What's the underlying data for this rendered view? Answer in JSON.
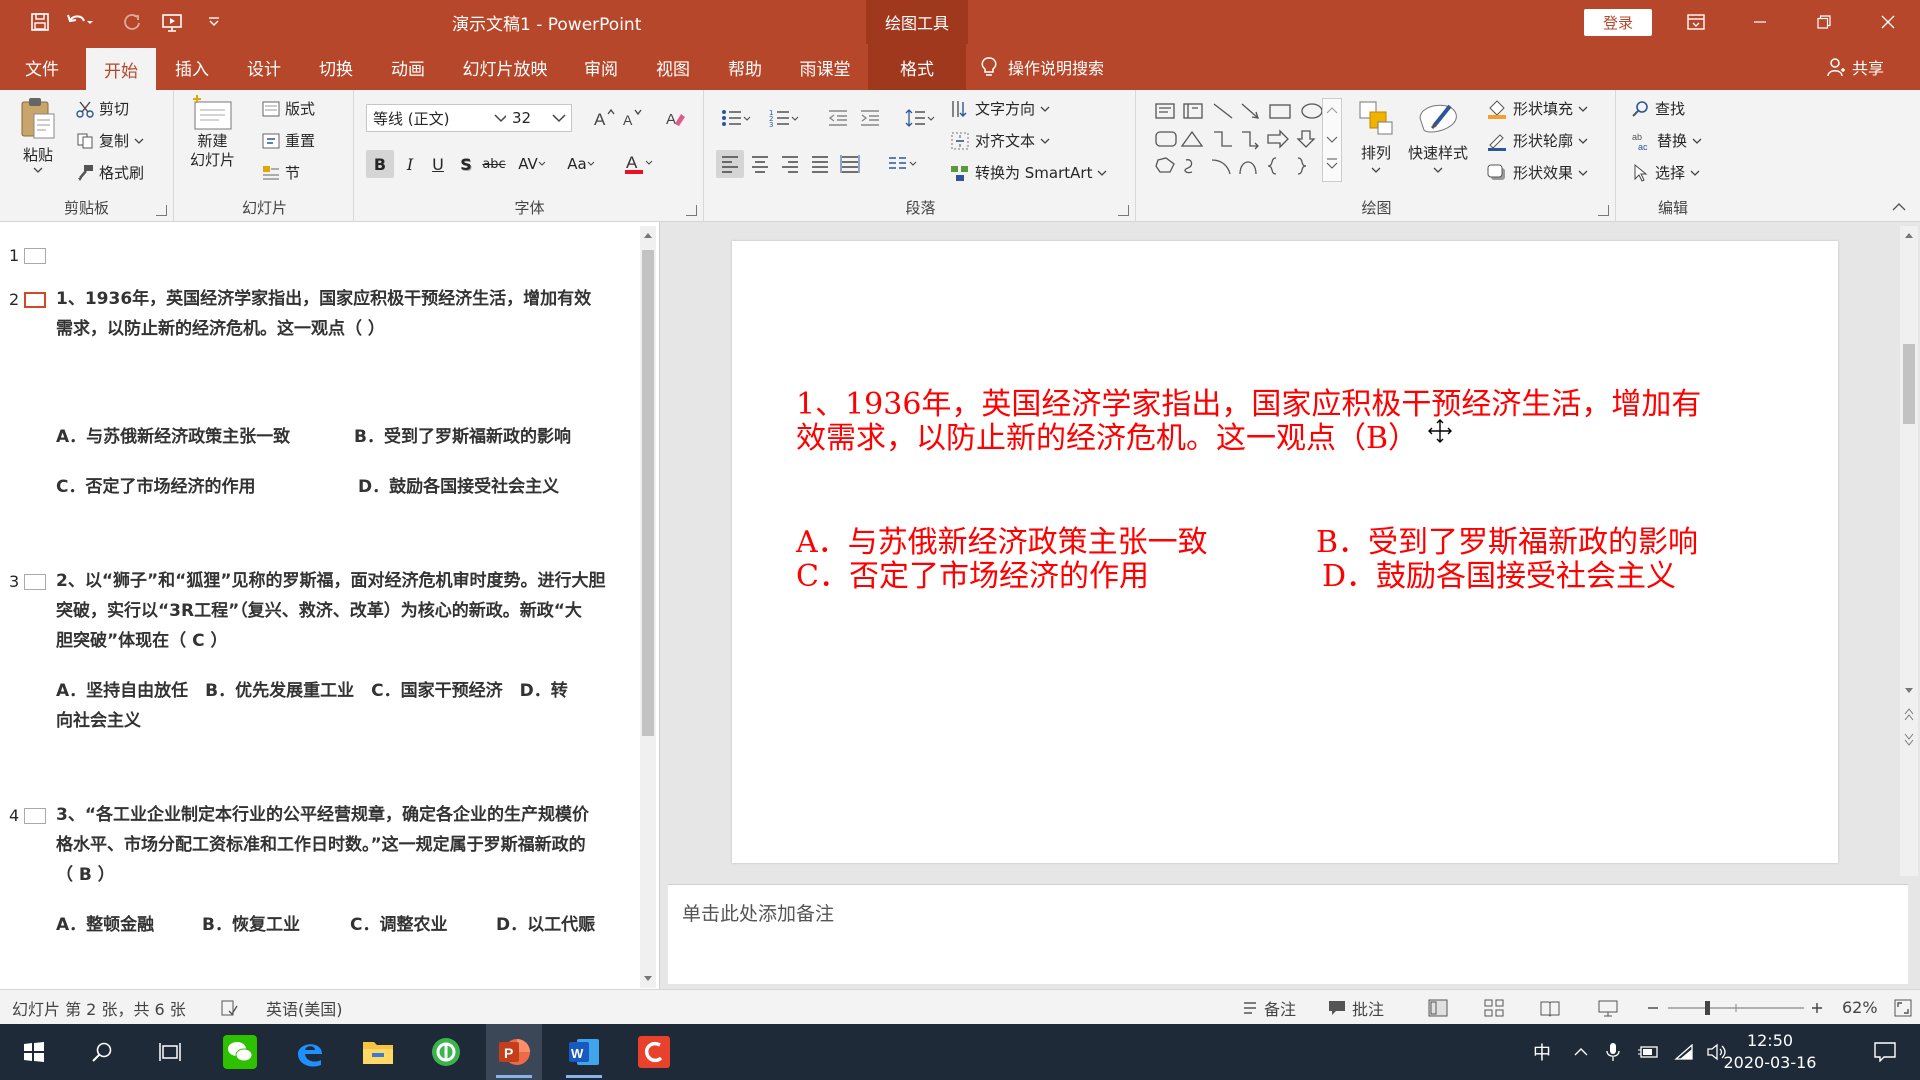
{
  "window": {
    "title": "演示文稿1  -  PowerPoint",
    "context_tool": "绘图工具",
    "login": "登录"
  },
  "tabs": [
    "文件",
    "开始",
    "插入",
    "设计",
    "切换",
    "动画",
    "幻灯片放映",
    "审阅",
    "视图",
    "帮助",
    "雨课堂",
    "格式"
  ],
  "tell_me": "操作说明搜索",
  "share": "共享",
  "ribbon": {
    "clipboard": {
      "paste": "粘贴",
      "cut": "剪切",
      "copy": "复制",
      "format_painter": "格式刷",
      "label": "剪贴板"
    },
    "slides": {
      "new_slide_1": "新建",
      "new_slide_2": "幻灯片",
      "layout": "版式",
      "reset": "重置",
      "section": "节",
      "label": "幻灯片"
    },
    "font": {
      "font_name": "等线 (正文)",
      "font_size": "32",
      "label": "字体"
    },
    "paragraph": {
      "text_direction": "文字方向",
      "align_text": "对齐文本",
      "smartart": "转换为 SmartArt",
      "label": "段落"
    },
    "drawing": {
      "arrange": "排列",
      "quick_styles": "快速样式",
      "shape_fill": "形状填充",
      "shape_outline": "形状轮廓",
      "shape_effects": "形状效果",
      "label": "绘图"
    },
    "editing": {
      "find": "查找",
      "replace": "替换",
      "select": "选择",
      "label": "编辑"
    }
  },
  "thumbnails": [
    {
      "num": "1",
      "lines": []
    },
    {
      "num": "2",
      "lines": [
        "1、1936年，英国经济学家指出，国家应积极干预经济生活，增加有效",
        "需求，以防止新的经济危机。这一观点（ ）",
        "A．与苏俄新经济政策主张一致",
        "B．受到了罗斯福新政的影响",
        "C．否定了市场经济的作用",
        "D．鼓励各国接受社会主义"
      ]
    },
    {
      "num": "3",
      "lines": [
        "2、以“狮子”和“狐狸”见称的罗斯福，面对经济危机审时度势。进行大胆",
        "突破，实行以“3R工程”（复兴、救济、改革）为核心的新政。新政“大",
        "胆突破”体现在（ C ）",
        "A．坚持自由放任　B．优先发展重工业　C．国家干预经济　D．转",
        "向社会主义"
      ]
    },
    {
      "num": "4",
      "lines": [
        "3、“各工业企业制定本行业的公平经营规章，确定各企业的生产规模价",
        "格水平、市场分配工资标准和工作日时数。”这一规定属于罗斯福新政的",
        "（ B ）",
        "A．整顿金融",
        "B．恢复工业",
        "C．调整农业",
        "D．以工代赈"
      ]
    }
  ],
  "slide": {
    "line1": "1、1936年，英国经济学家指出，国家应积极干预经济生活，增加有",
    "line2": "效需求，以防止新的经济危机。这一观点（B）",
    "optA": "A．与苏俄新经济政策主张一致",
    "optB": "B．受到了罗斯福新政的影响",
    "optC": "C．否定了市场经济的作用",
    "optD": "D．鼓励各国接受社会主义",
    "text_color": "#ff0000"
  },
  "notes_placeholder": "单击此处添加备注",
  "status": {
    "slide_info": "幻灯片 第 2 张，共 6 张",
    "language": "英语(美国)",
    "notes": "备注",
    "comments": "批注",
    "zoom": "62%"
  },
  "taskbar": {
    "time": "12:50",
    "date": "2020-03-16",
    "ime": "中"
  },
  "colors": {
    "accent": "#b7472a",
    "slide_text": "#ff0000"
  }
}
